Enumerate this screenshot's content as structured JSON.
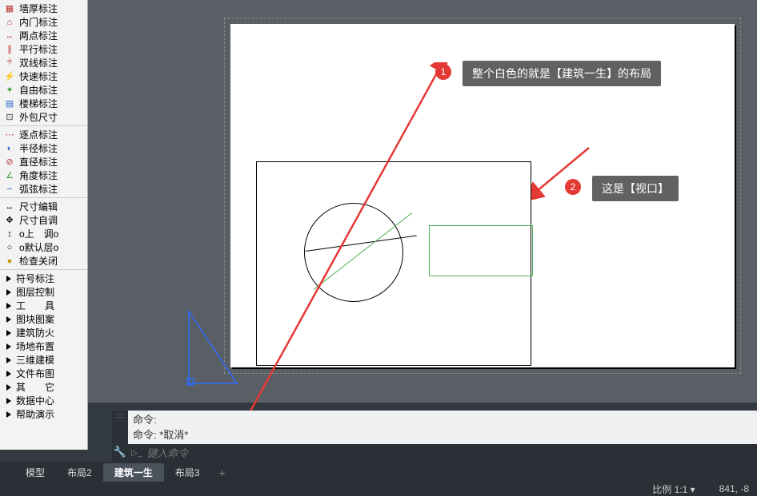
{
  "sidebar": {
    "group1": [
      {
        "icon": "墙",
        "label": "墙厚标注",
        "color": "#b33"
      },
      {
        "icon": "门",
        "label": "内门标注",
        "color": "#b33"
      },
      {
        "icon": "↔",
        "label": "两点标注",
        "color": "#b33"
      },
      {
        "icon": "∥",
        "label": "平行标注",
        "color": "#b33"
      },
      {
        "icon": "≡",
        "label": "双线标注",
        "color": "#b33"
      },
      {
        "icon": "⚡",
        "label": "快速标注",
        "color": "#36c"
      },
      {
        "icon": "✦",
        "label": "自由标注",
        "color": "#393"
      },
      {
        "icon": "▤",
        "label": "楼梯标注",
        "color": "#36c"
      },
      {
        "icon": "⊡",
        "label": "外包尺寸",
        "color": "#333"
      }
    ],
    "group2": [
      {
        "icon": "⋯",
        "label": "逐点标注",
        "color": "#b33"
      },
      {
        "icon": "◐",
        "label": "半径标注",
        "color": "#36c"
      },
      {
        "icon": "⊘",
        "label": "直径标注",
        "color": "#b33"
      },
      {
        "icon": "∠",
        "label": "角度标注",
        "color": "#393"
      },
      {
        "icon": "⌢",
        "label": "弧弦标注",
        "color": "#36c"
      }
    ],
    "group3": [
      {
        "label": "尺寸编辑"
      },
      {
        "label": "尺寸自调"
      },
      {
        "label": "o上　调o"
      },
      {
        "label": "o默认层o"
      },
      {
        "label": "检查关闭"
      }
    ],
    "group4": [
      {
        "label": "符号标注"
      },
      {
        "label": "图层控制"
      },
      {
        "label": "工　　具"
      },
      {
        "label": "图块图案"
      },
      {
        "label": "建筑防火"
      },
      {
        "label": "场地布置"
      },
      {
        "label": "三维建模"
      },
      {
        "label": "文件布图"
      },
      {
        "label": "其　　它"
      },
      {
        "label": "数据中心"
      },
      {
        "label": "帮助演示"
      }
    ],
    "g3icons": [
      "↔",
      "✥",
      "↕",
      "○",
      "●"
    ]
  },
  "callouts": {
    "c1": "整个白色的就是【建筑一生】的布局",
    "c2": "这是【视口】",
    "b1": "1",
    "b2": "2"
  },
  "command": {
    "h1": "命令:",
    "h2": "命令: *取消*",
    "placeholder": "键入命令"
  },
  "tabs": {
    "t1": "模型",
    "t2": "布局2",
    "t3": "建筑一生",
    "t4": "布局3",
    "add": "+"
  },
  "status": {
    "scale": "比例 1:1 ▾",
    "coord": "841, -8"
  }
}
